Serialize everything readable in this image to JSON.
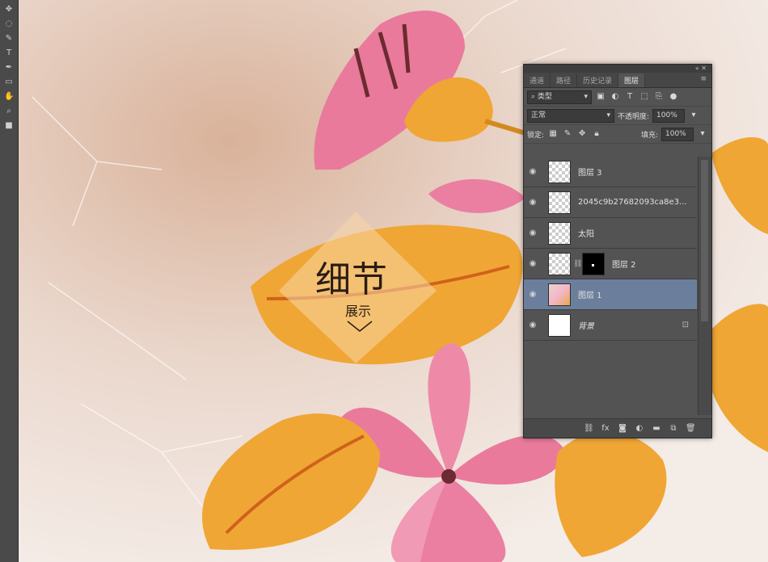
{
  "overlay": {
    "title": "细节",
    "subtitle": "展示"
  },
  "panel": {
    "tabs": [
      {
        "label": "通道",
        "active": false
      },
      {
        "label": "路径",
        "active": false
      },
      {
        "label": "历史记录",
        "active": false
      },
      {
        "label": "图层",
        "active": true
      }
    ],
    "filter": {
      "kind": "类型"
    },
    "blend_mode": "正常",
    "opacity_label": "不透明度:",
    "opacity_value": "100%",
    "lock_label": "锁定:",
    "fill_label": "填充:",
    "fill_value": "100%",
    "layers": [
      {
        "name": "图层 3",
        "thumb": "transparent",
        "selected": false
      },
      {
        "name": "2045c9b27682093ca8e3...",
        "thumb": "transparent",
        "selected": false
      },
      {
        "name": "太阳",
        "thumb": "transparent",
        "selected": false
      },
      {
        "name": "图层 2",
        "thumb": "transparent",
        "mask": true,
        "selected": false
      },
      {
        "name": "图层 1",
        "thumb": "art",
        "selected": true
      },
      {
        "name": "背景",
        "thumb": "white",
        "selected": false,
        "locked": true
      }
    ],
    "bottom_icons": [
      "link-icon",
      "fx-icon",
      "mask-icon",
      "adjustment-icon",
      "folder-icon",
      "new-layer-icon",
      "trash-icon"
    ]
  },
  "colors": {
    "panel_bg": "#535353",
    "selected_layer": "#6b7f9c",
    "leaf_orange": "#f0a634",
    "flower_pink": "#e97a9c"
  }
}
